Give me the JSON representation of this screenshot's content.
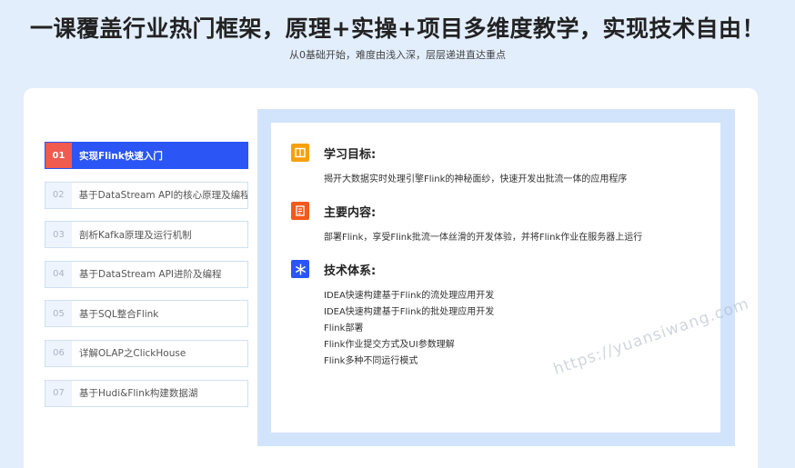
{
  "header": {
    "title": "一课覆盖行业热门框架，原理+实操+项目多维度教学，实现技术自由！",
    "subtitle": "从0基础开始，难度由浅入深，层层递进直达重点"
  },
  "nav": {
    "items": [
      {
        "num": "01",
        "label": "实现Flink快速入门"
      },
      {
        "num": "02",
        "label": "基于DataStream API的核心原理及编程"
      },
      {
        "num": "03",
        "label": "剖析Kafka原理及运行机制"
      },
      {
        "num": "04",
        "label": "基于DataStream API进阶及编程"
      },
      {
        "num": "05",
        "label": "基于SQL整合Flink"
      },
      {
        "num": "06",
        "label": "详解OLAP之ClickHouse"
      },
      {
        "num": "07",
        "label": "基于Hudi&Flink构建数据湖"
      }
    ]
  },
  "detail": {
    "goal": {
      "icon": "book-icon",
      "color": "#f5a00f",
      "title": "学习目标:",
      "body": "揭开大数据实时处理引擎Flink的神秘面纱，快速开发出批流一体的应用程序"
    },
    "content": {
      "icon": "document-icon",
      "color": "#f25a1a",
      "title": "主要内容:",
      "body": "部署Flink，享受Flink批流一体丝滑的开发体验，并将Flink作业在服务器上运行"
    },
    "system": {
      "icon": "snowflake-icon",
      "color": "#2b55f5",
      "title": "技术体系:",
      "lines": [
        "IDEA快速构建基于Flink的流处理应用开发",
        "IDEA快速构建基于Flink的批处理应用开发",
        "Flink部署",
        "Flink作业提交方式及UI参数理解",
        "Flink多种不同运行模式"
      ]
    }
  },
  "watermark": "https://yuansiwang.com"
}
